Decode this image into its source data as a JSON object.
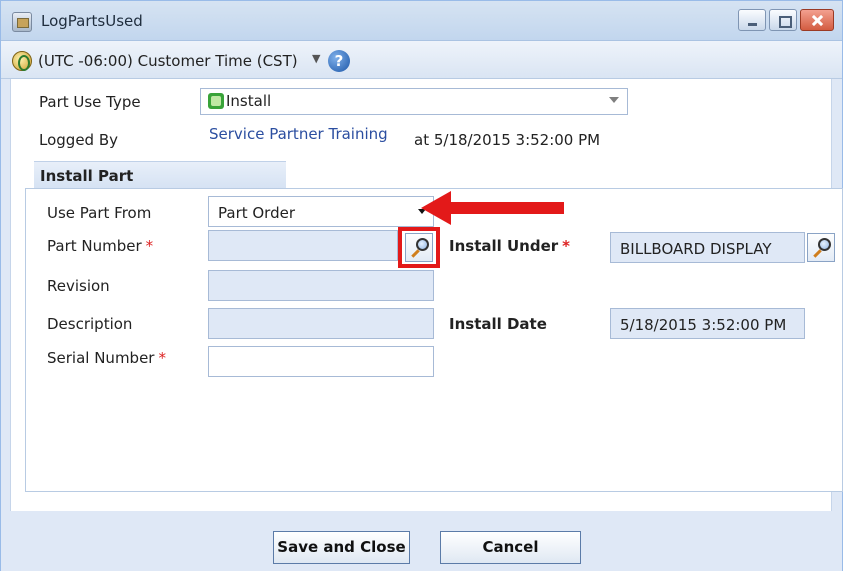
{
  "window": {
    "title": "LogPartsUsed"
  },
  "timezone": {
    "label": "(UTC -06:00) Customer Time (CST)"
  },
  "form": {
    "part_use_type_label": "Part Use Type",
    "part_use_type_value": "Install",
    "logged_by_label": "Logged By",
    "logged_by_user": "Service Partner Training",
    "logged_at": "at  5/18/2015 3:52:00 PM"
  },
  "install_part": {
    "section_title": "Install Part",
    "use_part_from_label": "Use Part From",
    "use_part_from_value": "Part Order",
    "part_number_label": "Part Number",
    "revision_label": "Revision",
    "description_label": "Description",
    "serial_number_label": "Serial Number",
    "install_under_label": "Install Under",
    "install_under_value": "BILLBOARD DISPLAY",
    "install_date_label": "Install Date",
    "install_date_value": "5/18/2015 3:52:00 PM",
    "required_marker": "*"
  },
  "footer": {
    "save_label": "Save and Close",
    "cancel_label": "Cancel"
  },
  "colors": {
    "annotation": "#e31919",
    "link": "#2b4ea0",
    "required": "#dd2222"
  },
  "icons": [
    "app-icon",
    "minimize-icon",
    "maximize-icon",
    "close-icon",
    "globe-icon",
    "help-icon",
    "puzzle-icon",
    "chevron-down-icon",
    "magnifier-icon",
    "arrow-annotation-icon"
  ]
}
